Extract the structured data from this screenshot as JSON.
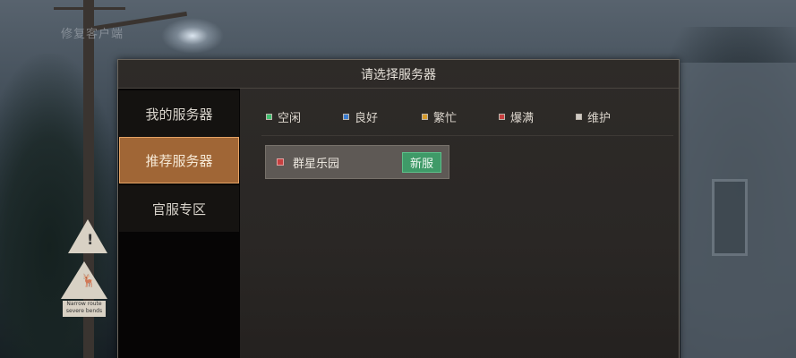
{
  "background": {
    "overlay_text": "修复客户端",
    "sign_plate_text": "Narrow route severe bends",
    "sign_warning_glyph": "!",
    "sign_deer_glyph": "🦌"
  },
  "dialog": {
    "title": "请选择服务器"
  },
  "sidebar": {
    "items": [
      {
        "label": "我的服务器"
      },
      {
        "label": "推荐服务器"
      },
      {
        "label": "官服专区"
      }
    ]
  },
  "legend": {
    "items": [
      {
        "label": "空闲",
        "color": "#3fbf6f"
      },
      {
        "label": "良好",
        "color": "#3b7ccf"
      },
      {
        "label": "繁忙",
        "color": "#d69a2a"
      },
      {
        "label": "爆满",
        "color": "#c84040"
      },
      {
        "label": "维护",
        "color": "#cfcac4"
      }
    ]
  },
  "servers": [
    {
      "name": "群星乐园",
      "badge": "新服",
      "status_color": "#c84040",
      "badge_color": "#3f9a68"
    }
  ],
  "colors": {
    "selected_tab": "#a06636",
    "dialog_bg": "#2a2725"
  }
}
